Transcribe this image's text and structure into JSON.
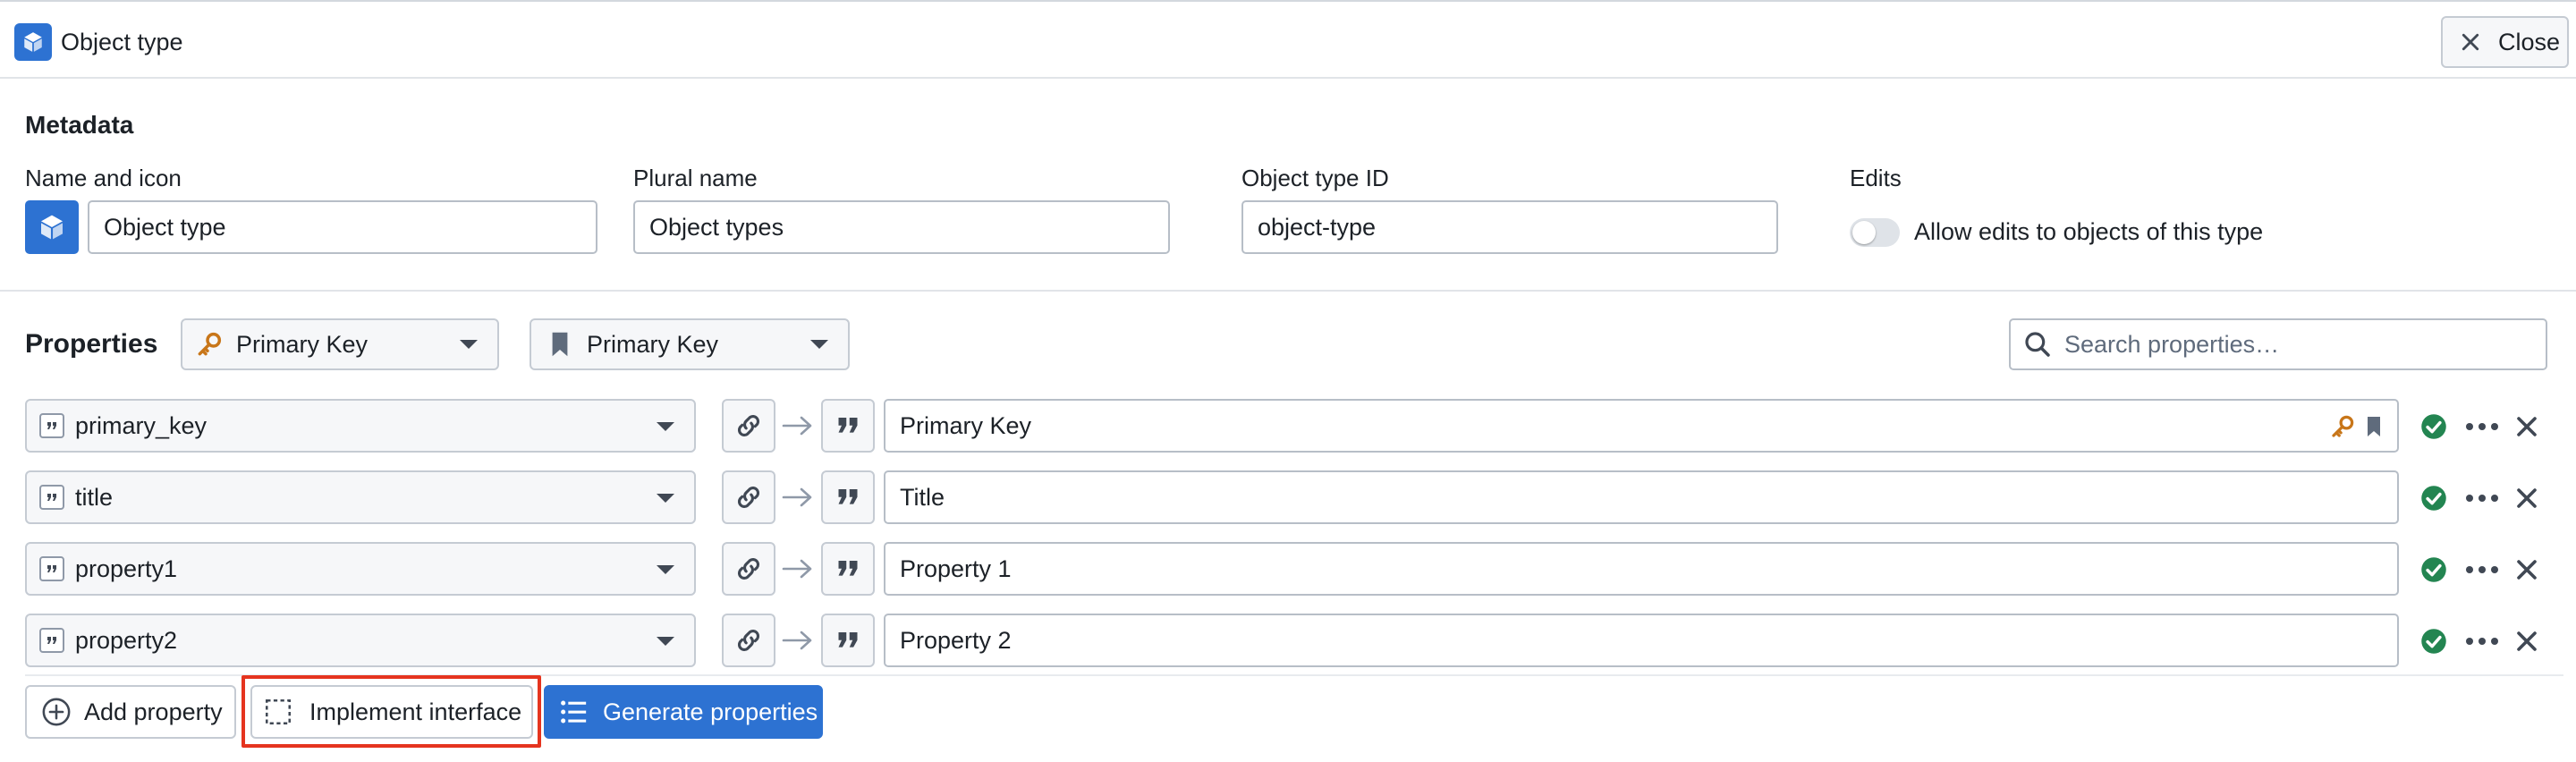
{
  "header": {
    "title": "Object type",
    "close_label": "Close"
  },
  "metadata": {
    "section_title": "Metadata",
    "name_label": "Name and icon",
    "name_value": "Object type",
    "plural_label": "Plural name",
    "plural_value": "Object types",
    "id_label": "Object type ID",
    "id_value": "object-type",
    "edits_label": "Edits",
    "edits_toggle_label": "Allow edits to objects of this type",
    "edits_enabled": false
  },
  "properties": {
    "section_title": "Properties",
    "primary_key_dropdown": "Primary Key",
    "title_key_dropdown": "Primary Key",
    "search_placeholder": "Search properties…",
    "rows": [
      {
        "source": "primary_key",
        "display_name": "Primary Key",
        "is_primary_key": true,
        "is_title": true,
        "status": "valid"
      },
      {
        "source": "title",
        "display_name": "Title",
        "is_primary_key": false,
        "is_title": false,
        "status": "valid"
      },
      {
        "source": "property1",
        "display_name": "Property 1",
        "is_primary_key": false,
        "is_title": false,
        "status": "valid"
      },
      {
        "source": "property2",
        "display_name": "Property 2",
        "is_primary_key": false,
        "is_title": false,
        "status": "valid"
      }
    ]
  },
  "footer": {
    "add_property_label": "Add property",
    "implement_interface_label": "Implement interface",
    "generate_properties_label": "Generate properties"
  },
  "colors": {
    "accent": "#2d72d2",
    "success": "#238551",
    "key_gold": "#c87619",
    "highlight": "#e5341f"
  }
}
